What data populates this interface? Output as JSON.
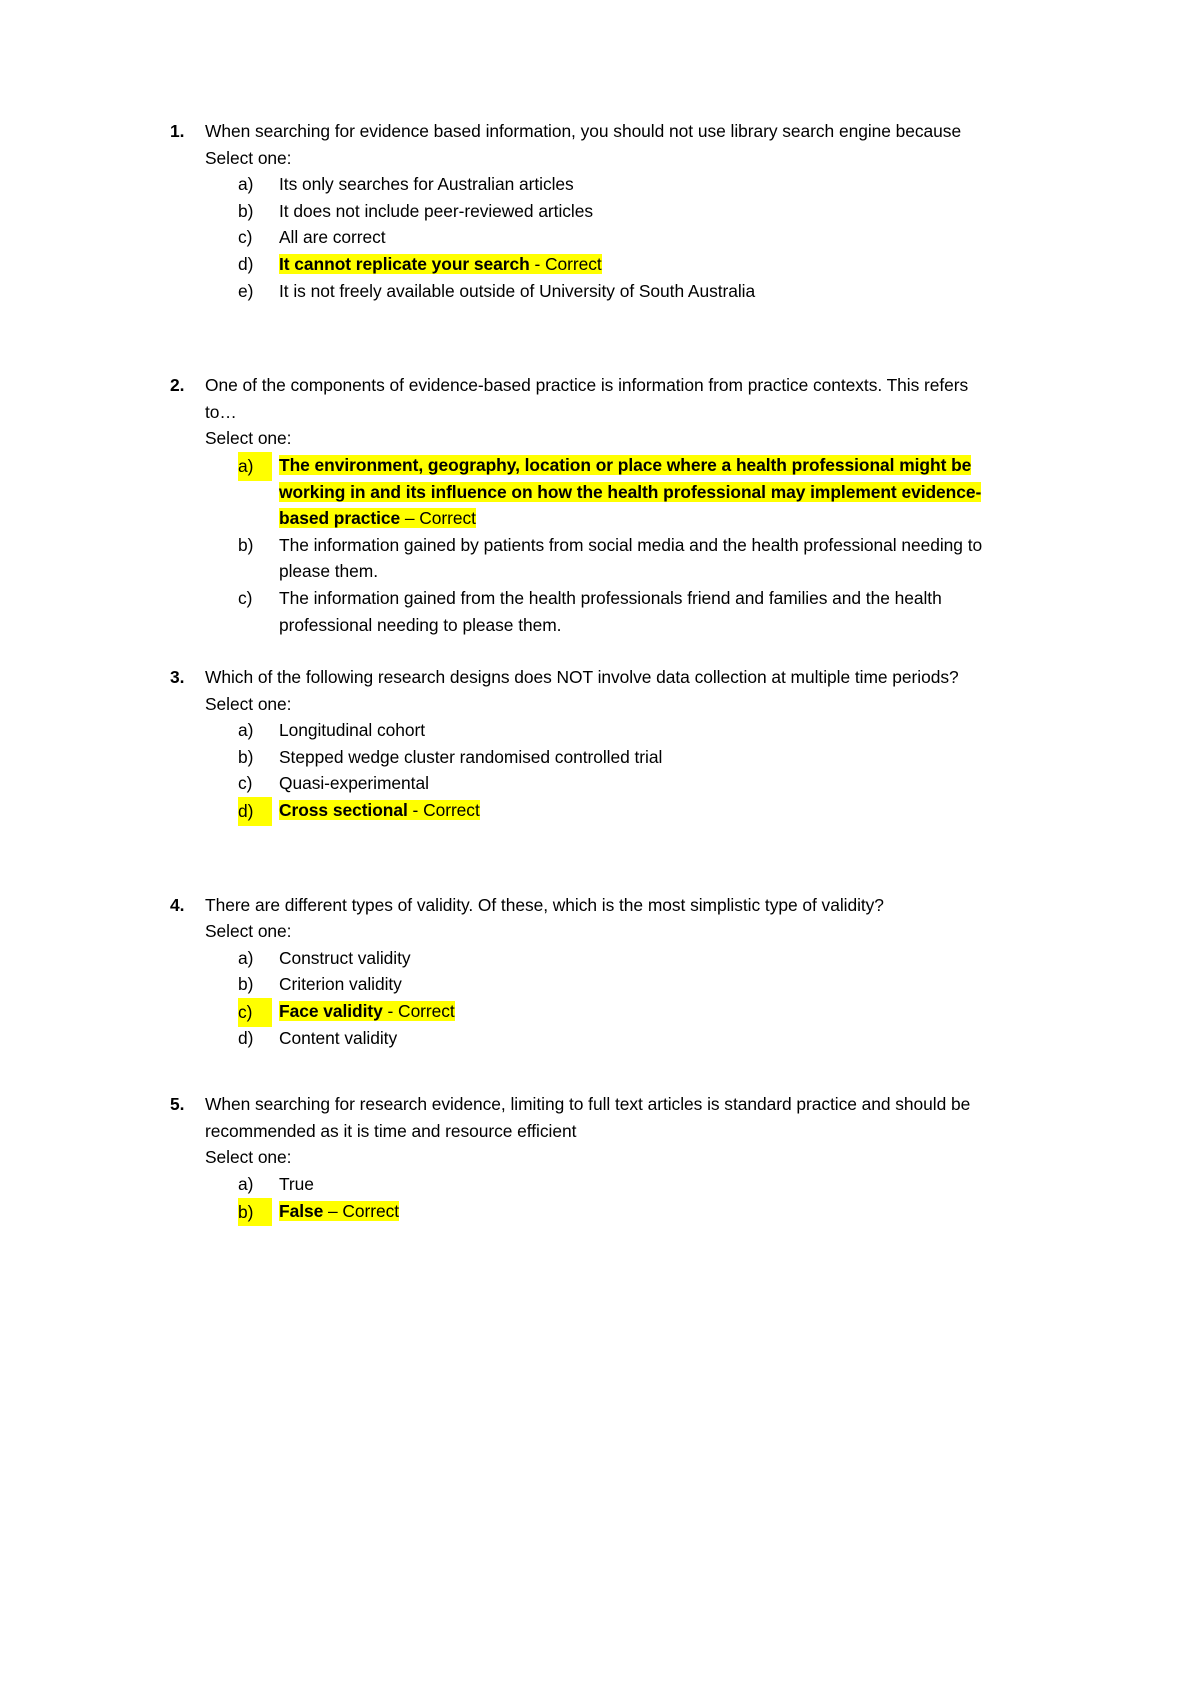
{
  "document": {
    "type": "quiz-answer-key",
    "highlight_color": "#ffff00",
    "questions": [
      {
        "number": "1.",
        "text": "When searching for evidence based information, you should not use library search engine because",
        "select_label": "Select one:",
        "options": [
          {
            "marker": "a)",
            "text": "Its only searches for Australian articles",
            "highlighted": false,
            "marker_highlighted": false,
            "bold_text": "",
            "suffix": ""
          },
          {
            "marker": "b)",
            "text": "It does not include peer-reviewed articles",
            "highlighted": false,
            "marker_highlighted": false,
            "bold_text": "",
            "suffix": ""
          },
          {
            "marker": "c)",
            "text": "All are correct",
            "highlighted": false,
            "marker_highlighted": false,
            "bold_text": "",
            "suffix": ""
          },
          {
            "marker": "d)",
            "text": "It cannot replicate your search - Correct",
            "highlighted": true,
            "marker_highlighted": false,
            "bold_text": "It cannot replicate your search",
            "suffix": " - Correct"
          },
          {
            "marker": "e)",
            "text": "It is not freely available outside of University of South Australia",
            "highlighted": false,
            "marker_highlighted": false,
            "bold_text": "",
            "suffix": ""
          }
        ]
      },
      {
        "number": "2.",
        "text": "One of the components of evidence-based practice is information from practice contexts. This refers to…",
        "select_label": "Select one:",
        "options": [
          {
            "marker": "a)",
            "text": "The environment, geography, location or place where a health professional might be working in and its influence on how the health professional may implement evidence-based practice – Correct",
            "highlighted": true,
            "marker_highlighted": true,
            "bold_text": "The environment, geography, location or place where a health professional might be working in and its influence on how the health professional may implement evidence-based practice",
            "suffix": " – Correct"
          },
          {
            "marker": "b)",
            "text": "The information gained by patients from social media and the health professional needing to please them.",
            "highlighted": false,
            "marker_highlighted": false,
            "bold_text": "",
            "suffix": ""
          },
          {
            "marker": "c)",
            "text": "The information gained from the health professionals friend and families and the health professional needing to please them.",
            "highlighted": false,
            "marker_highlighted": false,
            "bold_text": "",
            "suffix": ""
          }
        ]
      },
      {
        "number": "3.",
        "text": "Which of the following research designs does NOT involve data collection at multiple time periods?",
        "select_label": "Select one:",
        "options": [
          {
            "marker": "a)",
            "text": "Longitudinal cohort",
            "highlighted": false,
            "marker_highlighted": false,
            "bold_text": "",
            "suffix": ""
          },
          {
            "marker": "b)",
            "text": "Stepped wedge cluster randomised controlled trial",
            "highlighted": false,
            "marker_highlighted": false,
            "bold_text": "",
            "suffix": ""
          },
          {
            "marker": "c)",
            "text": "Quasi-experimental",
            "highlighted": false,
            "marker_highlighted": false,
            "bold_text": "",
            "suffix": ""
          },
          {
            "marker": "d)",
            "text": "Cross sectional - Correct",
            "highlighted": true,
            "marker_highlighted": true,
            "bold_text": "Cross sectional",
            "suffix": " - Correct"
          }
        ]
      },
      {
        "number": "4.",
        "text": "There are different types of validity. Of these, which is the most simplistic type of validity?",
        "select_label": "Select one:",
        "options": [
          {
            "marker": "a)",
            "text": "Construct validity",
            "highlighted": false,
            "marker_highlighted": false,
            "bold_text": "",
            "suffix": ""
          },
          {
            "marker": "b)",
            "text": "Criterion validity",
            "highlighted": false,
            "marker_highlighted": false,
            "bold_text": "",
            "suffix": ""
          },
          {
            "marker": "c)",
            "text": "Face validity - Correct",
            "highlighted": true,
            "marker_highlighted": true,
            "bold_text": "Face validity",
            "suffix": " - Correct"
          },
          {
            "marker": "d)",
            "text": "Content validity",
            "highlighted": false,
            "marker_highlighted": false,
            "bold_text": "",
            "suffix": ""
          }
        ]
      },
      {
        "number": "5.",
        "text": "When searching for research evidence, limiting to full text articles is standard practice and should be recommended as it is time and resource efficient",
        "select_label": "Select one:",
        "options": [
          {
            "marker": "a)",
            "text": "True",
            "highlighted": false,
            "marker_highlighted": false,
            "bold_text": "",
            "suffix": ""
          },
          {
            "marker": "b)",
            "text": "False – Correct",
            "highlighted": true,
            "marker_highlighted": true,
            "bold_text": "False",
            "suffix": " – Correct"
          }
        ]
      }
    ],
    "question_gaps_after": [
      "gap-xl",
      "gap-sm",
      "gap-xl",
      "gap-md",
      "none"
    ]
  }
}
